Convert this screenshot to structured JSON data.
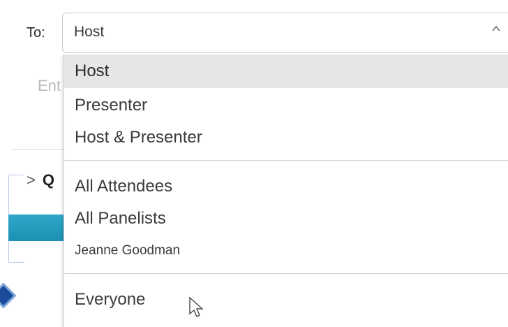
{
  "recipient": {
    "label": "To:",
    "selected": "Host",
    "caret": "^"
  },
  "message_input": {
    "placeholder_partial": "Ent"
  },
  "qa_section": {
    "chevron": ">",
    "label_partial": "Q"
  },
  "dropdown": {
    "options": [
      {
        "label": "Host",
        "selected": true
      },
      {
        "label": "Presenter"
      },
      {
        "label": "Host & Presenter"
      },
      {
        "label": "All Attendees"
      },
      {
        "label": "All Panelists"
      },
      {
        "label": "Jeanne Goodman"
      },
      {
        "label": "Everyone"
      }
    ]
  },
  "colors": {
    "accent_teal": "#1c90b3",
    "selected_bg": "#e6e6e6",
    "badge_blue": "#1a4c9b"
  },
  "icons": {
    "caret": "chevron-up-icon",
    "section_toggle": "chevron-right-icon",
    "pointer": "mouse-cursor-icon"
  }
}
